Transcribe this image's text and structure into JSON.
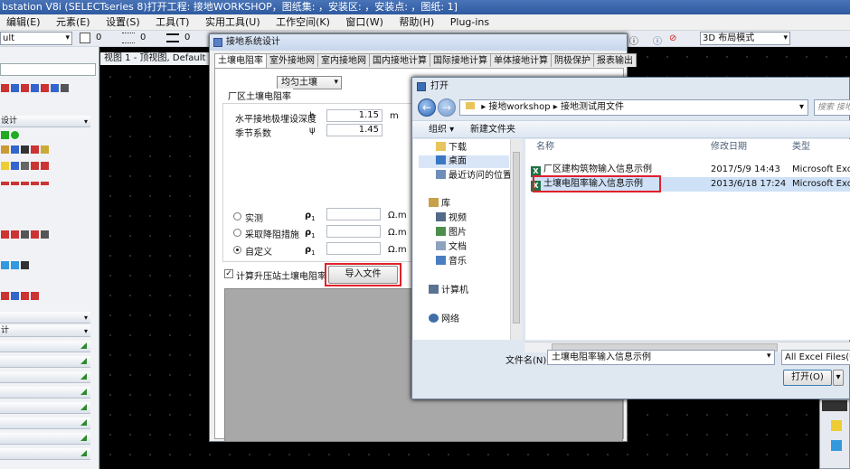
{
  "app": {
    "title": "bstation V8i (SELECTseries 8)打开工程: 接地WORKSHOP，图纸集: ，安装区: ，安装点: ，图纸: 1]"
  },
  "menu": [
    "编辑(E)",
    "元素(E)",
    "设置(S)",
    "工具(T)",
    "实用工具(U)",
    "工作空间(K)",
    "窗口(W)",
    "帮助(H)",
    "Plug-ins"
  ],
  "toolbar": {
    "level_combo": "ult",
    "num1": "0",
    "num2": "0",
    "num3": "0",
    "layout_combo": "3D 布局模式"
  },
  "leftpanel": {
    "header_label": "设计",
    "sections": [
      "计"
    ]
  },
  "view": {
    "title": "视图 1 - 顶视图, Default"
  },
  "ground_dialog": {
    "title": "接地系统设计",
    "tabs": [
      "土壤电阻率",
      "室外接地网",
      "室内接地网",
      "国内接地计算",
      "国际接地计算",
      "单体接地计算",
      "阴极保护",
      "报表输出"
    ],
    "soil_type": "均匀土壤",
    "group_label": "厂区土壤电阻率",
    "depth_label": "水平接地极埋设深度",
    "depth_symbol": "h",
    "depth_value": "1.15",
    "depth_unit": "m",
    "season_label": "季节系数",
    "season_symbol": "ψ",
    "season_value": "1.45",
    "options": [
      {
        "label": "实测",
        "symbol": "ρ",
        "sub": "1",
        "value": "",
        "unit": "Ω.m",
        "selected": false
      },
      {
        "label": "采取降阻措施",
        "symbol": "ρ",
        "sub": "1",
        "value": "",
        "unit": "Ω.m",
        "selected": false
      },
      {
        "label": "自定义",
        "symbol": "ρ",
        "sub": "1",
        "value": "",
        "unit": "Ω.m",
        "selected": true
      }
    ],
    "checkbox_label": "计算升压站土壤电阻率",
    "checkbox_checked": true,
    "import_button": "导入文件"
  },
  "open_dialog": {
    "title": "打开",
    "path": [
      "接地workshop",
      "接地测试用文件"
    ],
    "search_placeholder": "搜索 接地",
    "organize": "组织 ▾",
    "new_folder": "新建文件夹",
    "nav": [
      {
        "label": "下载",
        "icon": "download-folder-icon"
      },
      {
        "label": "桌面",
        "icon": "desktop-icon"
      },
      {
        "label": "最近访问的位置",
        "icon": "recent-places-icon"
      },
      {
        "label": "库",
        "icon": "library-icon"
      },
      {
        "label": "视频",
        "icon": "video-icon"
      },
      {
        "label": "图片",
        "icon": "pictures-icon"
      },
      {
        "label": "文档",
        "icon": "documents-icon"
      },
      {
        "label": "音乐",
        "icon": "music-icon"
      },
      {
        "label": "计算机",
        "icon": "computer-icon"
      },
      {
        "label": "网络",
        "icon": "network-icon"
      }
    ],
    "columns": [
      "名称",
      "修改日期",
      "类型"
    ],
    "files": [
      {
        "name": "厂区建构筑物输入信息示例",
        "date": "2017/5/9 14:43",
        "type": "Microsoft Excel"
      },
      {
        "name": "土壤电阻率输入信息示例",
        "date": "2013/6/18 17:24",
        "type": "Microsoft Excel"
      }
    ],
    "filename_label": "文件名(N):",
    "filename_value": "土壤电阻率输入信息示例",
    "filetype_value": "All Excel Files(*.xl",
    "open_button": "打开(O)"
  },
  "colors": {
    "accent_red": "#e0202a",
    "titlebar_blue": "#2e5aa0",
    "excel_green": "#207245"
  }
}
